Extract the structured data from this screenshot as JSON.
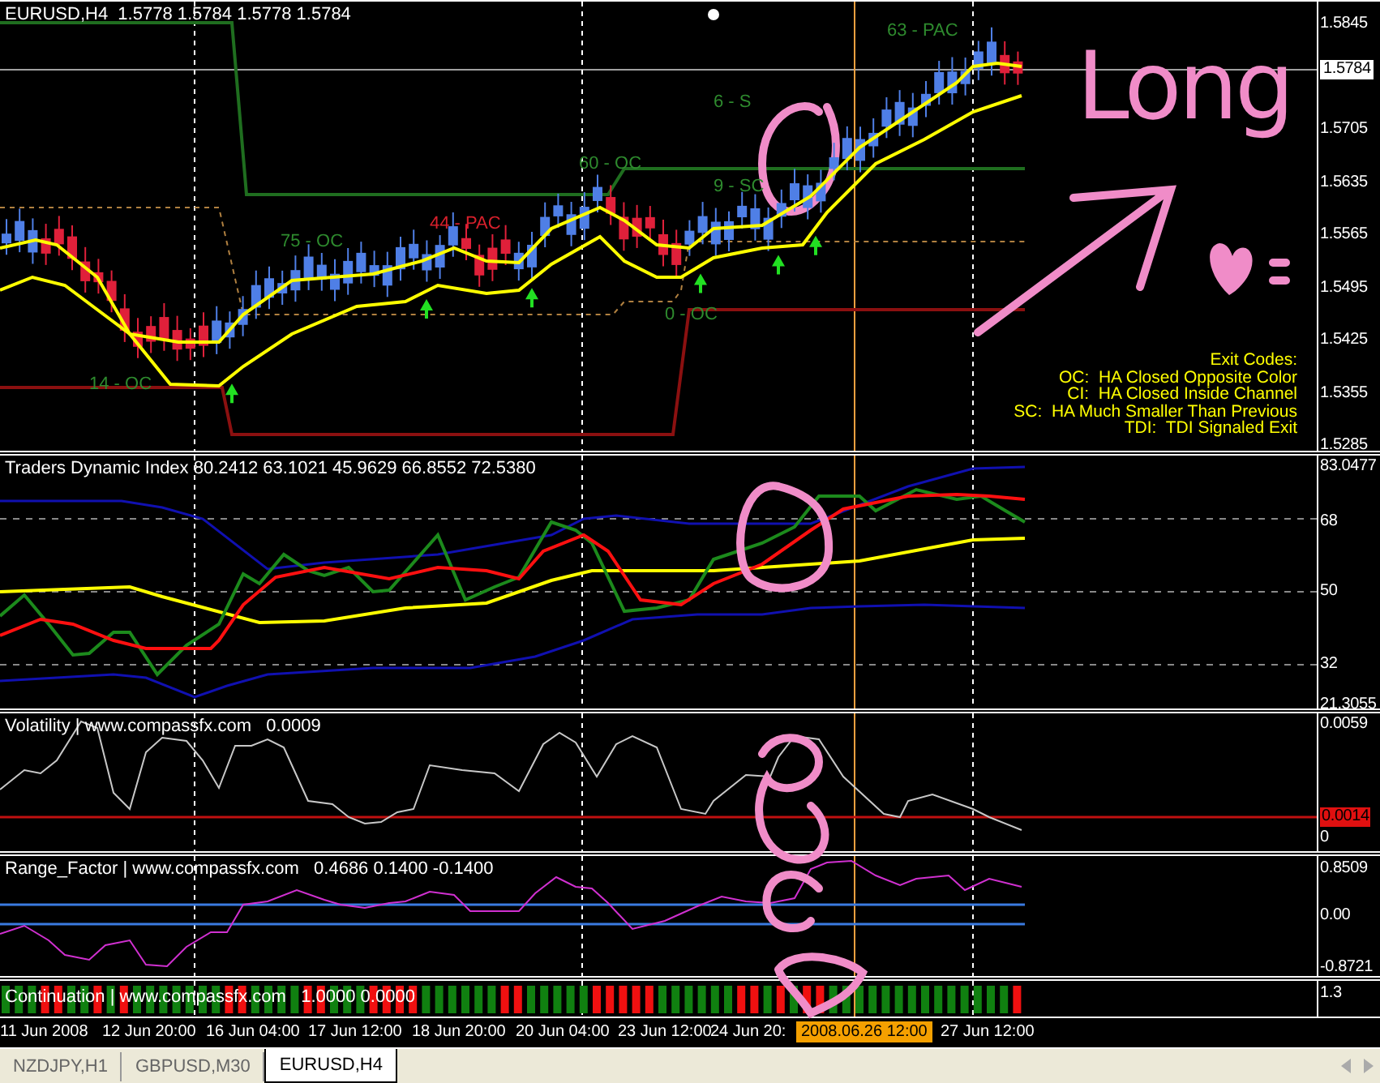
{
  "chart": {
    "header": "EURUSD,H4  1.5778 1.5784 1.5778 1.5784",
    "price_axis": [
      "1.5845",
      "1.5705",
      "1.5635",
      "1.5565",
      "1.5495",
      "1.5425",
      "1.5355",
      "1.5285"
    ],
    "current_price": "1.5784",
    "signal_labels": [
      {
        "text": "75 - OC",
        "color": "#2e8b2e"
      },
      {
        "text": "44 - PAC",
        "color": "#d8202c"
      },
      {
        "text": "60 - OC",
        "color": "#2e8b2e"
      },
      {
        "text": "9 - SC",
        "color": "#2e8b2e"
      },
      {
        "text": "6 - S",
        "color": "#2e8b2e"
      },
      {
        "text": "63 - PAC",
        "color": "#2e8b2e"
      },
      {
        "text": "14 - OC",
        "color": "#2e8b2e"
      },
      {
        "text": "0 - OC",
        "color": "#2e8b2e"
      }
    ],
    "legend": {
      "title": "Exit Codes:",
      "lines": [
        "OC:  HA Closed Opposite Color",
        "CI:  HA Closed Inside Channel",
        "SC:  HA Much Smaller Than Previous",
        "TDI:  TDI Signaled Exit"
      ]
    }
  },
  "annotation": {
    "text": "Long"
  },
  "indicators": [
    {
      "title": "Traders Dynamic Index 80.2412 63.1021 45.9629 66.8552 72.5380",
      "axis": [
        "83.0477",
        "68",
        "50",
        "32",
        "21.3055"
      ]
    },
    {
      "title": "Volatility | www.compassfx.com   0.0009",
      "axis": [
        "0.0059",
        "0"
      ],
      "current": "0.0014"
    },
    {
      "title": "Range_Factor | www.compassfx.com   0.4686 0.1400 -0.1400",
      "axis": [
        "0.8509",
        "0.00",
        "-0.8721"
      ]
    },
    {
      "title": "Continuation | www.compassfx.com   1.0000 0.0000",
      "axis": [
        "1.3"
      ]
    }
  ],
  "continuation": {
    "bars": [
      {
        "color": "#108010"
      },
      {
        "color": "#108010"
      },
      {
        "color": "#108010"
      },
      {
        "color": "#f01010"
      },
      {
        "color": "#f01010"
      },
      {
        "color": "#108010"
      },
      {
        "color": "#108010"
      },
      {
        "color": "#f01010"
      },
      {
        "color": "#108010"
      },
      {
        "color": "#f01010"
      },
      {
        "color": "#108010"
      },
      {
        "color": "#108010"
      },
      {
        "color": "#108010"
      },
      {
        "color": "#108010"
      },
      {
        "color": "#108010"
      },
      {
        "color": "#108010"
      },
      {
        "color": "#108010"
      },
      {
        "color": "#f01010"
      },
      {
        "color": "#f01010"
      },
      {
        "color": "#108010"
      },
      {
        "color": "#108010"
      },
      {
        "color": "#108010"
      },
      {
        "color": "#108010"
      },
      {
        "color": "#f01010"
      },
      {
        "color": "#f01010"
      },
      {
        "color": "#108010"
      },
      {
        "color": "#108010"
      },
      {
        "color": "#108010"
      },
      {
        "color": "#f01010"
      },
      {
        "color": "#f01010"
      },
      {
        "color": "#f01010"
      },
      {
        "color": "#f01010"
      },
      {
        "color": "#108010"
      },
      {
        "color": "#108010"
      },
      {
        "color": "#108010"
      },
      {
        "color": "#108010"
      },
      {
        "color": "#108010"
      },
      {
        "color": "#108010"
      },
      {
        "color": "#f01010"
      },
      {
        "color": "#f01010"
      },
      {
        "color": "#108010"
      },
      {
        "color": "#108010"
      },
      {
        "color": "#108010"
      },
      {
        "color": "#108010"
      },
      {
        "color": "#108010"
      },
      {
        "color": "#f01010"
      },
      {
        "color": "#f01010"
      },
      {
        "color": "#f01010"
      },
      {
        "color": "#f01010"
      },
      {
        "color": "#f01010"
      },
      {
        "color": "#108010"
      },
      {
        "color": "#108010"
      },
      {
        "color": "#108010"
      },
      {
        "color": "#108010"
      },
      {
        "color": "#108010"
      },
      {
        "color": "#108010"
      },
      {
        "color": "#f01010"
      },
      {
        "color": "#f01010"
      },
      {
        "color": "#108010"
      },
      {
        "color": "#f01010"
      },
      {
        "color": "#108010"
      },
      {
        "color": "#f01010"
      },
      {
        "color": "#f01010"
      },
      {
        "color": "#108010"
      },
      {
        "color": "#108010"
      },
      {
        "color": "#108010"
      },
      {
        "color": "#108010"
      },
      {
        "color": "#108010"
      },
      {
        "color": "#108010"
      },
      {
        "color": "#108010"
      },
      {
        "color": "#108010"
      },
      {
        "color": "#108010"
      },
      {
        "color": "#108010"
      },
      {
        "color": "#108010"
      },
      {
        "color": "#108010"
      },
      {
        "color": "#108010"
      },
      {
        "color": "#108010"
      },
      {
        "color": "#f01010"
      }
    ]
  },
  "time_axis": [
    {
      "text": "11 Jun 2008",
      "highlighted": false
    },
    {
      "text": "12 Jun 20:00",
      "highlighted": false
    },
    {
      "text": "16 Jun 04:00",
      "highlighted": false
    },
    {
      "text": "17 Jun 12:00",
      "highlighted": false
    },
    {
      "text": "18 Jun 20:00",
      "highlighted": false
    },
    {
      "text": "20 Jun 04:00",
      "highlighted": false
    },
    {
      "text": "23 Jun 12:00",
      "highlighted": false
    },
    {
      "text": "24 Jun 20:",
      "highlighted": false
    },
    {
      "text": "2008.06.26 12:00",
      "highlighted": true
    },
    {
      "text": "27 Jun 12:00",
      "highlighted": false
    }
  ],
  "tabs": [
    {
      "label": "NZDJPY,H1",
      "selected": false
    },
    {
      "label": "GBPUSD,M30",
      "selected": false
    },
    {
      "label": "EURUSD,H4",
      "selected": true
    }
  ]
}
